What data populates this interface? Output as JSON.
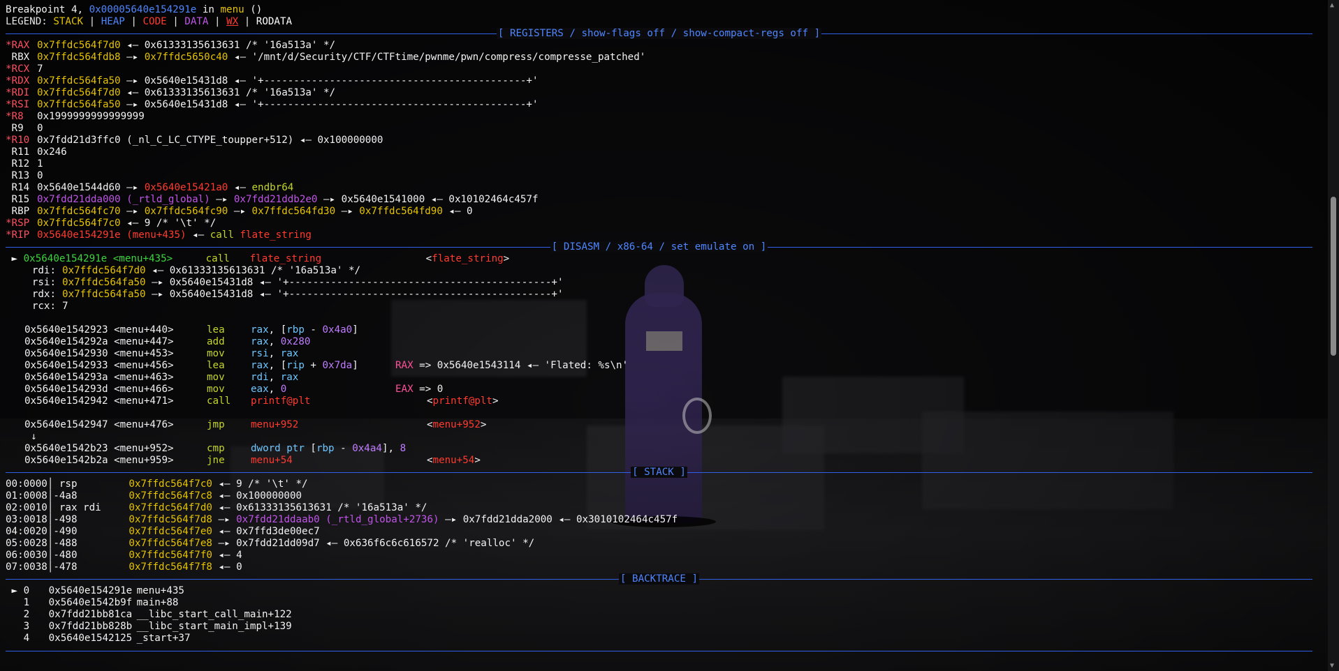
{
  "breakpoint": {
    "prefix": "Breakpoint 4, ",
    "addr": "0x00005640e154291e",
    "in": " in ",
    "func": "menu",
    "tail": " ()"
  },
  "legend": {
    "label": "LEGEND: ",
    "stack": "STACK",
    "heap": "HEAP",
    "code": "CODE",
    "data": "DATA",
    "wx": "WX",
    "rodata": "RODATA",
    "sep": " | "
  },
  "headers": {
    "registers": "[ REGISTERS / show-flags off / show-compact-regs off ]",
    "disasm": "[ DISASM / x86-64 / set emulate on ]",
    "stack": "[ STACK ]",
    "backtrace": "[ BACKTRACE ]"
  },
  "registers": [
    {
      "mark": "*",
      "name": "RAX",
      "parts": [
        [
          "y",
          "0x7ffdc564f7d0"
        ],
        [
          "wt",
          " ◂— 0x61333135613631 /* '16a513a' */"
        ]
      ]
    },
    {
      "mark": " ",
      "name": "RBX",
      "parts": [
        [
          "y",
          "0x7ffdc564fdb8"
        ],
        [
          "wt",
          " —▸ "
        ],
        [
          "y",
          "0x7ffdc5650c40"
        ],
        [
          "wt",
          " ◂— '/mnt/d/Security/CTF/CTFtime/pwnme/pwn/compress/compresse_patched'"
        ]
      ]
    },
    {
      "mark": "*",
      "name": "RCX",
      "parts": [
        [
          "wt",
          "7"
        ]
      ]
    },
    {
      "mark": "*",
      "name": "RDX",
      "parts": [
        [
          "y",
          "0x7ffdc564fa50"
        ],
        [
          "wt",
          " —▸ 0x5640e15431d8 ◂— '+--------------------------------------------+'"
        ]
      ]
    },
    {
      "mark": "*",
      "name": "RDI",
      "parts": [
        [
          "y",
          "0x7ffdc564f7d0"
        ],
        [
          "wt",
          " ◂— 0x61333135613631 /* '16a513a' */"
        ]
      ]
    },
    {
      "mark": "*",
      "name": "RSI",
      "parts": [
        [
          "y",
          "0x7ffdc564fa50"
        ],
        [
          "wt",
          " —▸ 0x5640e15431d8 ◂— '+--------------------------------------------+'"
        ]
      ]
    },
    {
      "mark": "*",
      "name": "R8",
      "parts": [
        [
          "wt",
          "0x1999999999999999"
        ]
      ]
    },
    {
      "mark": " ",
      "name": "R9",
      "parts": [
        [
          "wt",
          "0"
        ]
      ]
    },
    {
      "mark": "*",
      "name": "R10",
      "parts": [
        [
          "wt",
          "0x7fdd21d3ffc0 (_nl_C_LC_CTYPE_toupper+512) ◂— 0x100000000"
        ]
      ]
    },
    {
      "mark": " ",
      "name": "R11",
      "parts": [
        [
          "wt",
          "0x246"
        ]
      ]
    },
    {
      "mark": " ",
      "name": "R12",
      "parts": [
        [
          "wt",
          "1"
        ]
      ]
    },
    {
      "mark": " ",
      "name": "R13",
      "parts": [
        [
          "wt",
          "0"
        ]
      ]
    },
    {
      "mark": " ",
      "name": "R14",
      "parts": [
        [
          "wt",
          "0x5640e1544d60 —▸ "
        ],
        [
          "r",
          "0x5640e15421a0"
        ],
        [
          "wt",
          " ◂— "
        ],
        [
          "mn",
          "endbr64"
        ]
      ]
    },
    {
      "mark": " ",
      "name": "R15",
      "parts": [
        [
          "p",
          "0x7fdd21dda000 (_rtld_global)"
        ],
        [
          "wt",
          " —▸ "
        ],
        [
          "p",
          "0x7fdd21ddb2e0"
        ],
        [
          "wt",
          " —▸ 0x5640e1541000 ◂— 0x10102464c457f"
        ]
      ]
    },
    {
      "mark": " ",
      "name": "RBP",
      "parts": [
        [
          "y",
          "0x7ffdc564fc70"
        ],
        [
          "wt",
          " —▸ "
        ],
        [
          "y",
          "0x7ffdc564fc90"
        ],
        [
          "wt",
          " —▸ "
        ],
        [
          "y",
          "0x7ffdc564fd30"
        ],
        [
          "wt",
          " —▸ "
        ],
        [
          "y",
          "0x7ffdc564fd90"
        ],
        [
          "wt",
          " ◂— 0"
        ]
      ]
    },
    {
      "mark": "*",
      "name": "RSP",
      "parts": [
        [
          "y",
          "0x7ffdc564f7c0"
        ],
        [
          "wt",
          " ◂— 9 /* '\\t' */"
        ]
      ]
    },
    {
      "mark": "*",
      "name": "RIP",
      "parts": [
        [
          "r",
          "0x5640e154291e (menu+435)"
        ],
        [
          "wt",
          " ◂— "
        ],
        [
          "mn",
          "call"
        ],
        [
          "wt",
          " "
        ],
        [
          "r",
          "flate_string"
        ]
      ]
    }
  ],
  "disasm": {
    "current": {
      "arrow": " ► ",
      "addr": "0x5640e154291e <menu+435>",
      "mn": "call",
      "op": "flate_string",
      "target": "<flate_string>"
    },
    "args": [
      {
        "name": "rdi:",
        "parts": [
          [
            "y",
            "0x7ffdc564f7d0"
          ],
          [
            "wt",
            " ◂— 0x61333135613631 /* '16a513a' */"
          ]
        ]
      },
      {
        "name": "rsi:",
        "parts": [
          [
            "y",
            "0x7ffdc564fa50"
          ],
          [
            "wt",
            " —▸ 0x5640e15431d8 ◂— '+--------------------------------------------+'"
          ]
        ]
      },
      {
        "name": "rdx:",
        "parts": [
          [
            "y",
            "0x7ffdc564fa50"
          ],
          [
            "wt",
            " —▸ 0x5640e15431d8 ◂— '+--------------------------------------------+'"
          ]
        ]
      },
      {
        "name": "rcx:",
        "parts": [
          [
            "wt",
            "7"
          ]
        ]
      }
    ],
    "lines": [
      {
        "addr": "0x5640e1542923 <menu+440>",
        "mn": "lea",
        "ops": [
          [
            "cy",
            "rax"
          ],
          [
            "wt",
            ", ["
          ],
          [
            "cy",
            "rbp"
          ],
          [
            "wt",
            " - "
          ],
          [
            "im",
            "0x4a0"
          ],
          [
            "wt",
            "]"
          ]
        ],
        "note": []
      },
      {
        "addr": "0x5640e154292a <menu+447>",
        "mn": "add",
        "ops": [
          [
            "cy",
            "rax"
          ],
          [
            "wt",
            ", "
          ],
          [
            "im",
            "0x280"
          ]
        ],
        "note": []
      },
      {
        "addr": "0x5640e1542930 <menu+453>",
        "mn": "mov",
        "ops": [
          [
            "cy",
            "rsi"
          ],
          [
            "wt",
            ", "
          ],
          [
            "cy",
            "rax"
          ]
        ],
        "note": []
      },
      {
        "addr": "0x5640e1542933 <menu+456>",
        "mn": "lea",
        "ops": [
          [
            "cy",
            "rax"
          ],
          [
            "wt",
            ", ["
          ],
          [
            "cy",
            "rip"
          ],
          [
            "wt",
            " + "
          ],
          [
            "im",
            "0x7da"
          ],
          [
            "wt",
            "]"
          ]
        ],
        "note": [
          [
            "rx",
            "RAX"
          ],
          [
            "wt",
            " => 0x5640e1543114 ◂— 'Flated: %s\\n'"
          ]
        ]
      },
      {
        "addr": "0x5640e154293a <menu+463>",
        "mn": "mov",
        "ops": [
          [
            "cy",
            "rdi"
          ],
          [
            "wt",
            ", "
          ],
          [
            "cy",
            "rax"
          ]
        ],
        "note": []
      },
      {
        "addr": "0x5640e154293d <menu+466>",
        "mn": "mov",
        "ops": [
          [
            "cy",
            "eax"
          ],
          [
            "wt",
            ", "
          ],
          [
            "im",
            "0"
          ]
        ],
        "note": [
          [
            "rx",
            "EAX"
          ],
          [
            "wt",
            " => 0"
          ]
        ]
      },
      {
        "addr": "0x5640e1542942 <menu+471>",
        "mn": "call",
        "ops": [
          [
            "r",
            "printf@plt"
          ]
        ],
        "target": "printf@plt",
        "note": []
      },
      {
        "blank": true
      },
      {
        "addr": "0x5640e1542947 <menu+476>",
        "mn": "jmp",
        "ops": [
          [
            "r",
            "menu+952"
          ]
        ],
        "target": "menu+952",
        "note": []
      },
      {
        "down": "↓"
      },
      {
        "addr": "0x5640e1542b23 <menu+952>",
        "mn": "cmp",
        "ops": [
          [
            "cy",
            "dword ptr"
          ],
          [
            "wt",
            " ["
          ],
          [
            "cy",
            "rbp"
          ],
          [
            "wt",
            " - "
          ],
          [
            "im",
            "0x4a4"
          ],
          [
            "wt",
            "], "
          ],
          [
            "im",
            "8"
          ]
        ],
        "note": []
      },
      {
        "addr": "0x5640e1542b2a <menu+959>",
        "mn": "jne",
        "ops": [
          [
            "r",
            "menu+54"
          ]
        ],
        "target": "menu+54",
        "note": []
      }
    ]
  },
  "stack": [
    {
      "idx": "00:0000",
      "off": " rsp    ",
      "addr": "0x7ffdc564f7c0",
      "rest": [
        [
          "wt",
          " ◂— 9 /* '\\t' */"
        ]
      ]
    },
    {
      "idx": "01:0008",
      "off": "-4a8    ",
      "addr": "0x7ffdc564f7c8",
      "rest": [
        [
          "wt",
          " ◂— 0x100000000"
        ]
      ]
    },
    {
      "idx": "02:0010",
      "off": " rax rdi",
      "addr": "0x7ffdc564f7d0",
      "rest": [
        [
          "wt",
          " ◂— 0x61333135613631 /* '16a513a' */"
        ]
      ]
    },
    {
      "idx": "03:0018",
      "off": "-498    ",
      "addr": "0x7ffdc564f7d8",
      "rest": [
        [
          "wt",
          " —▸ "
        ],
        [
          "p",
          "0x7fdd21ddaab0 (_rtld_global+2736)"
        ],
        [
          "wt",
          " —▸ 0x7fdd21dda2000 ◂— 0x3010102464c457f"
        ]
      ]
    },
    {
      "idx": "04:0020",
      "off": "-490    ",
      "addr": "0x7ffdc564f7e0",
      "rest": [
        [
          "wt",
          " ◂— 0x7ffd3de00ec7"
        ]
      ]
    },
    {
      "idx": "05:0028",
      "off": "-488    ",
      "addr": "0x7ffdc564f7e8",
      "rest": [
        [
          "wt",
          " —▸ 0x7fdd21dd09d7 ◂— 0x636f6c6c616572 /* 'realloc' */"
        ]
      ]
    },
    {
      "idx": "06:0030",
      "off": "-480    ",
      "addr": "0x7ffdc564f7f0",
      "rest": [
        [
          "wt",
          " ◂— 4"
        ]
      ]
    },
    {
      "idx": "07:0038",
      "off": "-478    ",
      "addr": "0x7ffdc564f7f8",
      "rest": [
        [
          "wt",
          " ◂— 0"
        ]
      ]
    }
  ],
  "backtrace": [
    {
      "mark": " ► ",
      "n": "0",
      "addr": "0x5640e154291e",
      "sym": "menu+435"
    },
    {
      "mark": "   ",
      "n": "1",
      "addr": "0x5640e1542b9f",
      "sym": "main+88"
    },
    {
      "mark": "   ",
      "n": "2",
      "addr": "0x7fdd21bb81ca",
      "sym": "__libc_start_call_main+122"
    },
    {
      "mark": "   ",
      "n": "3",
      "addr": "0x7fdd21bb828b",
      "sym": "__libc_start_main_impl+139"
    },
    {
      "mark": "   ",
      "n": "4",
      "addr": "0x5640e1542125",
      "sym": "_start+37"
    }
  ],
  "colors": {
    "stack": "#e5c300",
    "heap": "#4e86ff",
    "code": "#ff3b30",
    "data": "#c054e8",
    "rule": "#3060e8"
  }
}
